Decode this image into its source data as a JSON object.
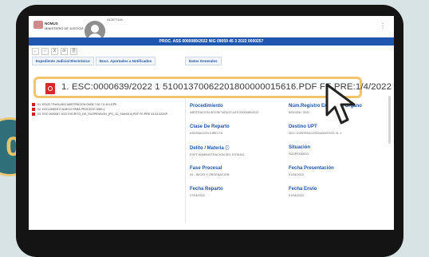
{
  "header": {
    "org_line1": "NOMUS",
    "org_line2": "MINISTERIO DE JUSTICIA",
    "user_id": "44287711K",
    "menu_icon": "kebab-icon"
  },
  "proc_bar": {
    "title": "PROC. ASS 0000089/2022 NIG 09059 45 3 2022 0000257"
  },
  "toolbar": {
    "buttons": [
      "←",
      "‹",
      "X",
      "⟳",
      "🗎"
    ]
  },
  "tabs": {
    "expediente": "Expediente Judicial Electrónico",
    "docs": "Docs. Aportados a Notificados",
    "datos": "Datos Generales"
  },
  "banner": {
    "text": "1. ESC:0000639/2022 1 51001370062201800000015616.PDF FE.PRE:1/4/2022",
    "icon": "pdf-icon"
  },
  "files": [
    "01. ESCR TRASLADO ABSTENCION 09/08 ? 00 ? 6 44 LEPE",
    "02. DOCUMENTO NUEVO PARA PROCESO 3059.1",
    "03. ESC 0000087 2022 ESCRITO_DE_SUSPENSION_(PS_1D_SIAN014) PDF FE.PRE 03.03.022DP"
  ],
  "details": {
    "procedimiento": {
      "label": "Procedimiento",
      "value": "ABSTENCION SECRETARIOS ASS 0000089/2022"
    },
    "num_registro": {
      "label": "Núm.Registro Entrada Y Organo",
      "value": "0000206 / 2022"
    },
    "clase_reparto": {
      "label": "Clase De Reparto",
      "value": "ASIGNACIÓN DIRECTA"
    },
    "destino_upt": {
      "label": "Destino UPT",
      "value": "JDO. CONTENCIOSO/ADMITIVO. N. 1"
    },
    "delito": {
      "label": "Delito / Materia",
      "value": "EXPT ADMINISTRACION DEL ESTADO"
    },
    "situacion": {
      "label": "Situación",
      "value": "SUSPENDIDO"
    },
    "fase": {
      "label": "Fase Procesal",
      "value": "00 - INICIO Y ORDENACION"
    },
    "fecha_presentacion": {
      "label": "Fecha Presentación",
      "value": "01/04/2022"
    },
    "fecha_reparto": {
      "label": "Fecha Reparto",
      "value": "07/04/2022"
    },
    "fecha_envio": {
      "label": "Fecha Envío",
      "value": "01/04/2022"
    }
  },
  "badge": {
    "number": "0"
  },
  "colors": {
    "accent": "#1e56b0",
    "highlight": "#f2c56b",
    "badge_bg": "#2e6f7a"
  }
}
